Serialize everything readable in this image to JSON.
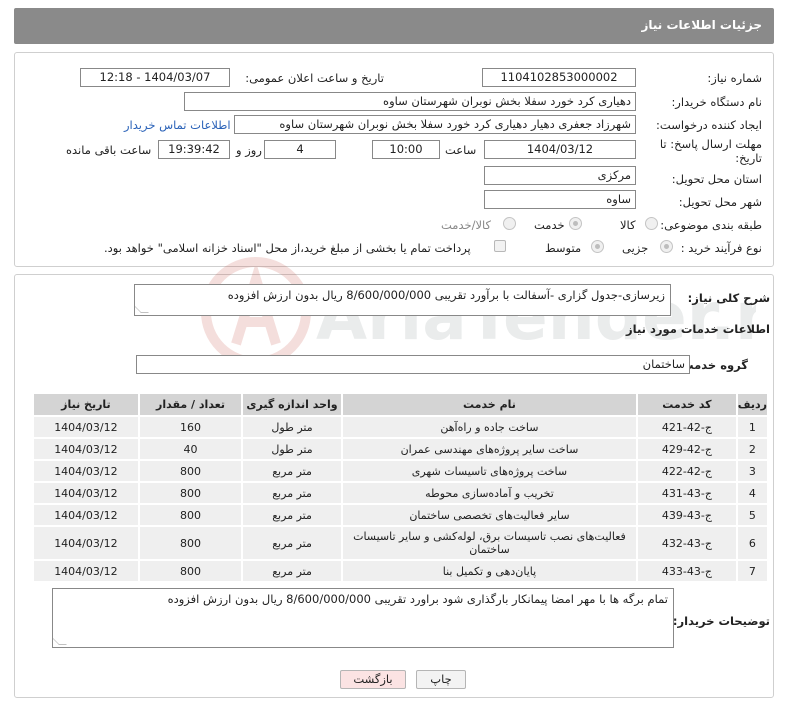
{
  "header": {
    "title": "جزئیات اطلاعات نیاز"
  },
  "need": {
    "number_label": "شماره نیاز:",
    "number_value": "1104102853000002",
    "announce_label": "تاریخ و ساعت اعلان عمومی:",
    "announce_value": "1404/03/07 - 12:18",
    "buyer_org_label": "نام دستگاه خریدار:",
    "buyer_org_value": "دهیاری کرد خورد سفلا بخش نوبران شهرستان ساوه",
    "creator_label": "ایجاد کننده درخواست:",
    "creator_value": "شهرزاد جعفری دهیار دهیاری کرد خورد سفلا بخش نوبران شهرستان ساوه",
    "contact_link": "اطلاعات تماس خریدار",
    "deadline_label_1": "مهلت ارسال پاسخ: تا",
    "deadline_label_2": "تاریخ:",
    "deadline_date": "1404/03/12",
    "time_label": "ساعت",
    "deadline_time": "10:00",
    "days_value": "4",
    "days_label": "روز و",
    "remaining_time": "19:39:42",
    "remaining_label": "ساعت باقی مانده",
    "province_label": "استان محل تحویل:",
    "province_value": "مرکزی",
    "city_label": "شهر محل تحویل:",
    "city_value": "ساوه",
    "category_label": "طبقه بندی موضوعی:",
    "category_options": [
      "کالا",
      "خدمت",
      "کالا/خدمت"
    ],
    "category_selected": "خدمت",
    "process_label": "نوع فرآیند خرید :",
    "process_options": [
      "جزیی",
      "متوسط"
    ],
    "process_selected": "جزیی",
    "payment_note": "پرداخت تمام یا بخشی از مبلغ خرید،از محل \"اسناد خزانه اسلامی\" خواهد بود."
  },
  "details": {
    "summary_label": "شرح کلی نیاز:",
    "summary_value": "زیرسازی-جدول گزاری -آسفالت با برآورد تقریبی 8/600/000/000 ریال بدون ارزش افزوده",
    "services_title": "اطلاعات خدمات مورد نیاز",
    "group_label": "گروه خدمت:",
    "group_value": "ساختمان"
  },
  "table": {
    "headers": [
      "ردیف",
      "کد خدمت",
      "نام خدمت",
      "واحد اندازه گیری",
      "تعداد / مقدار",
      "تاریخ نیاز"
    ],
    "rows": [
      {
        "idx": "1",
        "code": "ج-42-421",
        "name": "ساخت جاده و راه‌آهن",
        "unit": "متر طول",
        "qty": "160",
        "date": "1404/03/12"
      },
      {
        "idx": "2",
        "code": "ج-42-429",
        "name": "ساخت سایر پروژه‌های مهندسی عمران",
        "unit": "متر طول",
        "qty": "40",
        "date": "1404/03/12"
      },
      {
        "idx": "3",
        "code": "ج-42-422",
        "name": "ساخت پروژه‌های تاسیسات شهری",
        "unit": "متر مربع",
        "qty": "800",
        "date": "1404/03/12"
      },
      {
        "idx": "4",
        "code": "ج-43-431",
        "name": "تخریب و آماده‌سازی محوطه",
        "unit": "متر مربع",
        "qty": "800",
        "date": "1404/03/12"
      },
      {
        "idx": "5",
        "code": "ج-43-439",
        "name": "سایر فعالیت‌های تخصصی ساختمان",
        "unit": "متر مربع",
        "qty": "800",
        "date": "1404/03/12"
      },
      {
        "idx": "6",
        "code": "ج-43-432",
        "name": "فعالیت‌های نصب تاسیسات برق، لوله‌کشی و سایر تاسیسات ساختمان",
        "unit": "متر مربع",
        "qty": "800",
        "date": "1404/03/12"
      },
      {
        "idx": "7",
        "code": "ج-43-433",
        "name": "پایان‌دهی و تکمیل بنا",
        "unit": "متر مربع",
        "qty": "800",
        "date": "1404/03/12"
      }
    ]
  },
  "buyer_notes": {
    "label": "توضیحات خریدار:",
    "value": "تمام برگه ها با مهر امضا پیمانکار بارگذاری شود براورد تقریبی 8/600/000/000 ریال بدون ارزش افزوده"
  },
  "buttons": {
    "print": "چاپ",
    "back": "بازگشت"
  },
  "watermark": {
    "text": "AriaTender.neT"
  }
}
